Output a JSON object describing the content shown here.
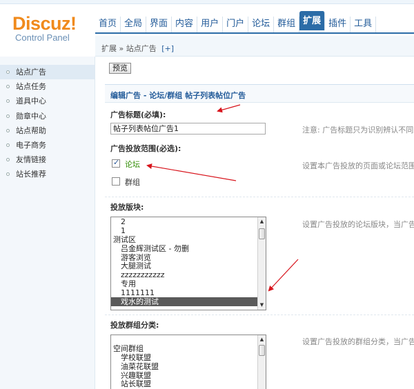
{
  "logo": {
    "main": "Discuz!",
    "sub": "Control Panel"
  },
  "nav": [
    {
      "label": "首页"
    },
    {
      "label": "全局"
    },
    {
      "label": "界面"
    },
    {
      "label": "内容"
    },
    {
      "label": "用户"
    },
    {
      "label": "门户"
    },
    {
      "label": "论坛"
    },
    {
      "label": "群组"
    },
    {
      "label": "扩展",
      "active": true
    },
    {
      "label": "插件"
    },
    {
      "label": "工具"
    }
  ],
  "breadcrumb": {
    "text": "扩展 » 站点广告",
    "add": "[+]"
  },
  "sidebar": [
    {
      "label": "站点广告",
      "active": true
    },
    {
      "label": "站点任务"
    },
    {
      "label": "道具中心"
    },
    {
      "label": "勋章中心"
    },
    {
      "label": "站点帮助"
    },
    {
      "label": "电子商务"
    },
    {
      "label": "友情链接"
    },
    {
      "label": "站长推荐"
    }
  ],
  "main": {
    "preview_button": "预览",
    "section_title": "编辑广告 - 论坛/群组 帖子列表帖位广告",
    "title_label": "广告标题(必填):",
    "title_value": "帖子列表帖位广告1",
    "title_note": "注意: 广告标题只为识别辨认不同广",
    "scope_label": "广告投放范围(必选):",
    "scope_options": [
      {
        "label": "论坛",
        "checked": true
      },
      {
        "label": "群组",
        "checked": false
      }
    ],
    "scope_note": "设置本广告投放的页面或论坛范围",
    "forum_label": "投放版块:",
    "forum_note": "设置广告投放的论坛版块，当广告投",
    "forum_options": [
      {
        "label": "　2"
      },
      {
        "label": "　1"
      },
      {
        "label": "测试区"
      },
      {
        "label": "　吕金辉测试区 - 勿删"
      },
      {
        "label": "　游客浏览"
      },
      {
        "label": "　大腿测试"
      },
      {
        "label": "　zzzzzzzzzzz"
      },
      {
        "label": "　专用"
      },
      {
        "label": "　1111111"
      },
      {
        "label": "　戏水的测试",
        "selected": true
      }
    ],
    "group_label": "投放群组分类:",
    "group_note": "设置广告投放的群组分类，当广告投",
    "group_options": [
      {
        "label": ""
      },
      {
        "label": "空间群组"
      },
      {
        "label": "　学校联盟"
      },
      {
        "label": "　油菜花联盟"
      },
      {
        "label": "　兴趣联盟"
      },
      {
        "label": "　站长联盟"
      }
    ]
  },
  "colors": {
    "brand_orange": "#f08a1c",
    "nav_blue": "#2b6ca7",
    "annotation_red": "#d8141c"
  }
}
